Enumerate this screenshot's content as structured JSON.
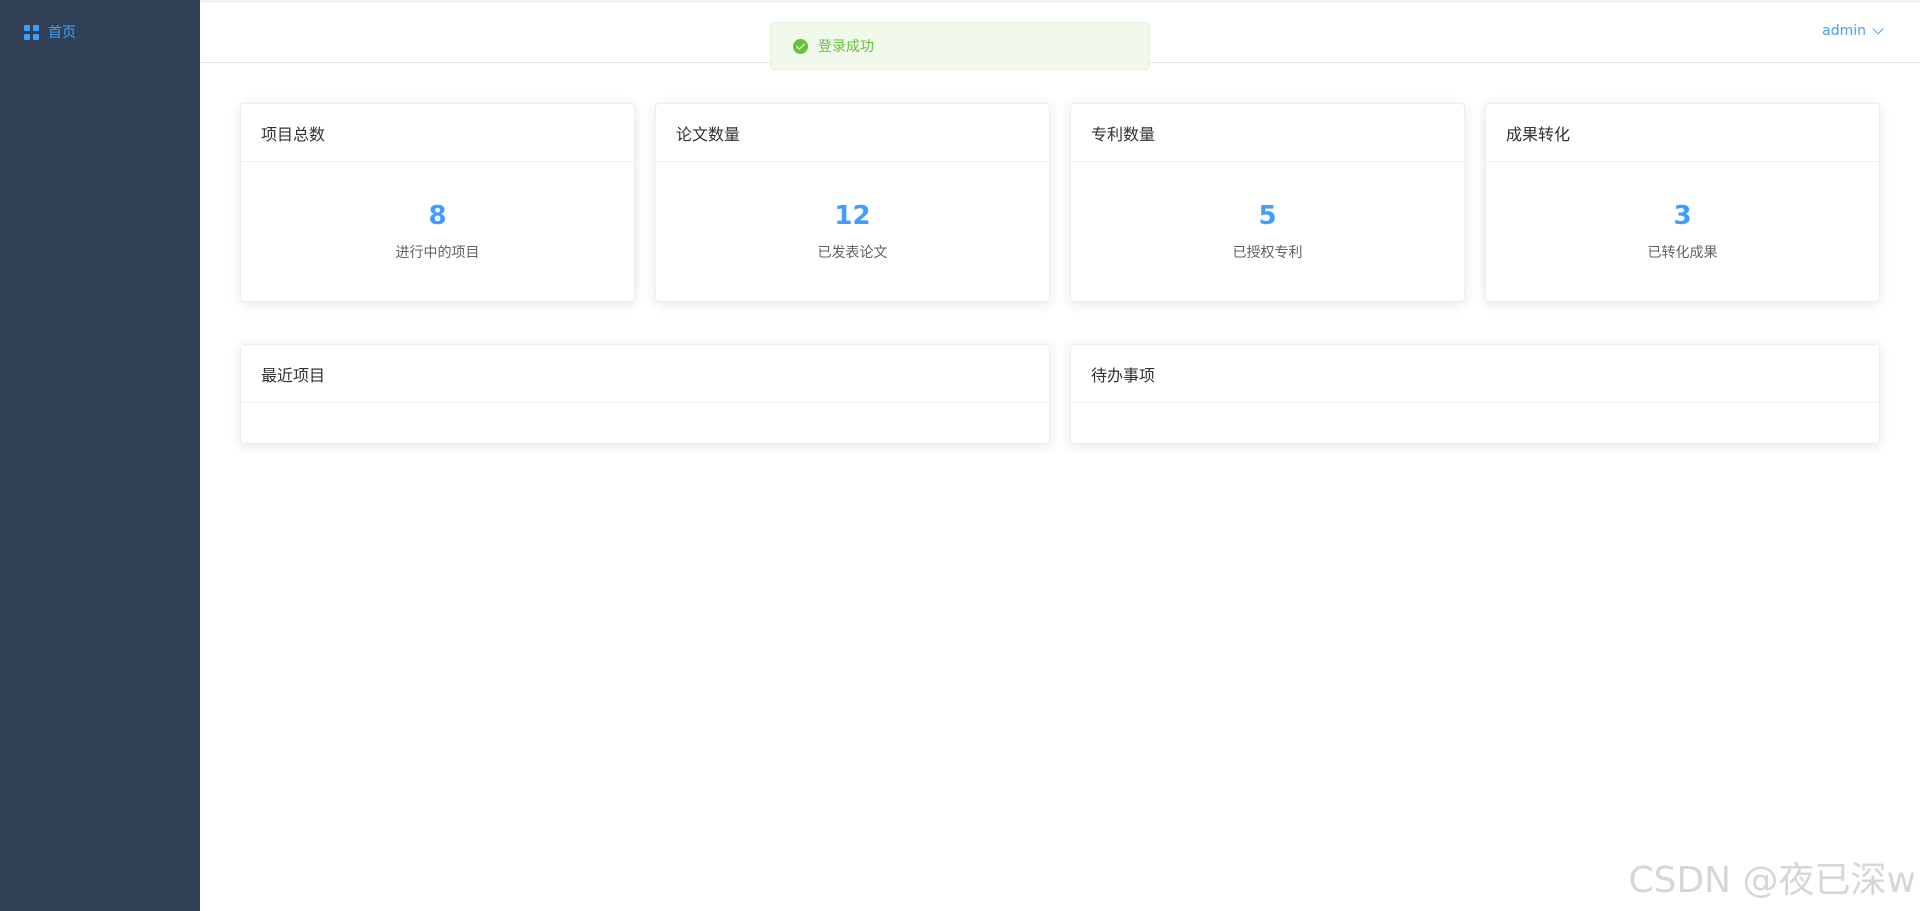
{
  "sidebar": {
    "items": [
      {
        "label": "首页",
        "icon": "dashboard-grid-icon",
        "active": true
      }
    ],
    "background": "#304156",
    "active_color": "#409eff"
  },
  "header": {
    "user": "admin"
  },
  "toast": {
    "message": "登录成功",
    "type": "success",
    "color": "#67c23a"
  },
  "stats": [
    {
      "title": "项目总数",
      "value": "8",
      "label": "进行中的项目"
    },
    {
      "title": "论文数量",
      "value": "12",
      "label": "已发表论文"
    },
    {
      "title": "专利数量",
      "value": "5",
      "label": "已授权专利"
    },
    {
      "title": "成果转化",
      "value": "3",
      "label": "已转化成果"
    }
  ],
  "panels": [
    {
      "title": "最近项目"
    },
    {
      "title": "待办事项"
    }
  ],
  "watermark": "CSDN @夜已深w"
}
